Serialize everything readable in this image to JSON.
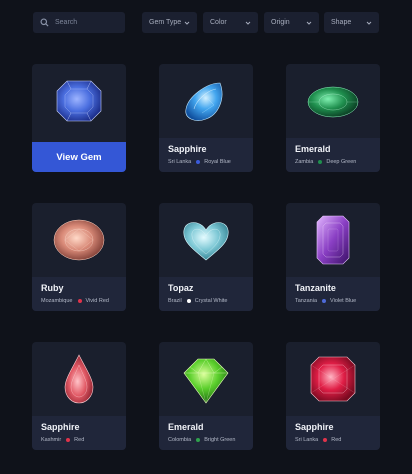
{
  "search": {
    "placeholder": "Search",
    "icon": "search-icon"
  },
  "filters": [
    {
      "label": "Gem Type"
    },
    {
      "label": "Color"
    },
    {
      "label": "Origin"
    },
    {
      "label": "Shape"
    }
  ],
  "view_button_label": "View Gem",
  "colors": {
    "accent": "#3457d6",
    "background": "#0f121a",
    "card": "#1a1f2d"
  },
  "gems": [
    {
      "name": "",
      "origin": "",
      "color_name": "",
      "color": "#4b6fe0",
      "shape": "cushion",
      "featured": true
    },
    {
      "name": "Sapphire",
      "origin": "Sri Lanka",
      "color_name": "Royal Blue",
      "color": "#3b5bdb",
      "shape": "pear-blue"
    },
    {
      "name": "Emerald",
      "origin": "Zambia",
      "color_name": "Deep Green",
      "color": "#1f8f4e",
      "shape": "oval-green"
    },
    {
      "name": "Ruby",
      "origin": "Mozambique",
      "color_name": "Vivid Red",
      "color": "#e0334b",
      "shape": "oval-peach"
    },
    {
      "name": "Topaz",
      "origin": "Brazil",
      "color_name": "Crystal White",
      "color": "#ffffff",
      "shape": "heart"
    },
    {
      "name": "Tanzanite",
      "origin": "Tanzania",
      "color_name": "Violet Blue",
      "color": "#4e6ad8",
      "shape": "emerald-cut"
    },
    {
      "name": "Sapphire",
      "origin": "Kashmir",
      "color_name": "Red",
      "color": "#e0334b",
      "shape": "pear-pink"
    },
    {
      "name": "Emerald",
      "origin": "Colombia",
      "color_name": "Bright Green",
      "color": "#2fa24d",
      "shape": "round-green"
    },
    {
      "name": "Sapphire",
      "origin": "Sri Lanka",
      "color_name": "Red",
      "color": "#e0334b",
      "shape": "radiant-red"
    }
  ]
}
